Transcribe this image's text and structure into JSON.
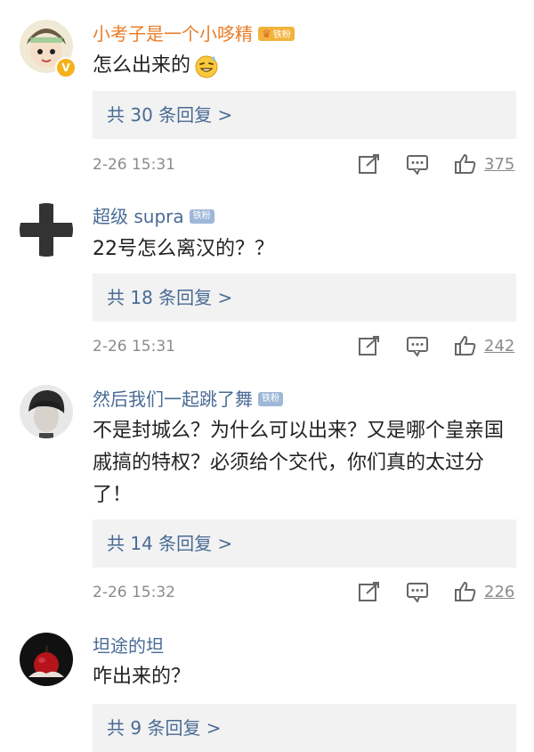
{
  "comments": [
    {
      "username": "小考子是一个小哆精",
      "badge": "铁粉",
      "text": "怎么出来的",
      "emoji": "grin-sweat-emoji",
      "replies": "共 30 条回复 >",
      "time": "2-26 15:31",
      "likes": "375",
      "verified": "V",
      "name_color": "#e97d28"
    },
    {
      "username": "超级 supra",
      "badge": "铁粉",
      "text": "22号怎么离汉的？？",
      "replies": "共 18 条回复 >",
      "time": "2-26 15:31",
      "likes": "242",
      "name_color": "#4a6b95"
    },
    {
      "username": "然后我们一起跳了舞",
      "badge": "铁粉",
      "text": "不是封城么？为什么可以出来？又是哪个皇亲国戚搞的特权？必须给个交代，你们真的太过分了！",
      "replies": "共 14 条回复 >",
      "time": "2-26 15:32",
      "likes": "226",
      "name_color": "#4a6b95"
    },
    {
      "username": "坦途的坦",
      "text": "咋出来的？",
      "replies": "共 9 条回复 >",
      "name_color": "#4a6b95"
    }
  ]
}
